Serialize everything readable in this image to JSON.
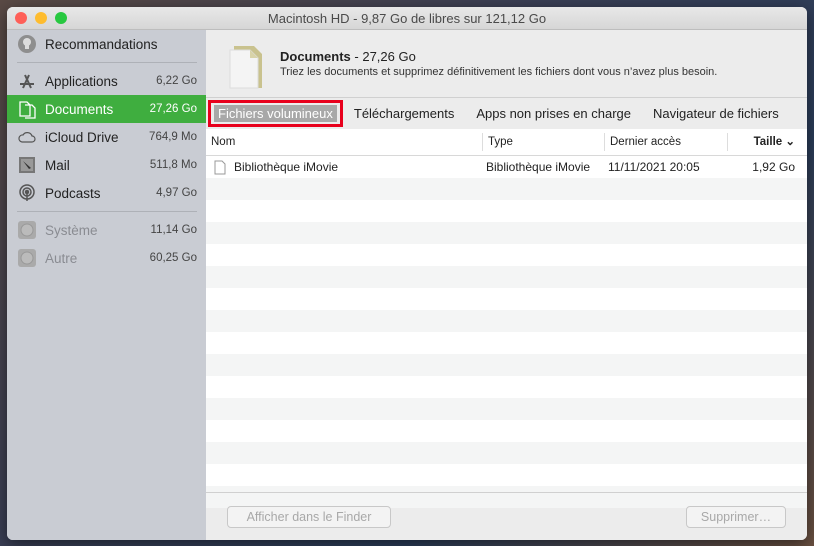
{
  "window": {
    "title": "Macintosh HD - 9,87 Go de libres sur 121,12 Go"
  },
  "sidebar": {
    "items": [
      {
        "label": "Recommandations",
        "size": "",
        "icon": "lightbulb-icon"
      },
      {
        "label": "Applications",
        "size": "6,22 Go",
        "icon": "app-store-icon"
      },
      {
        "label": "Documents",
        "size": "27,26 Go",
        "icon": "documents-icon"
      },
      {
        "label": "iCloud Drive",
        "size": "764,9 Mo",
        "icon": "cloud-icon"
      },
      {
        "label": "Mail",
        "size": "511,8 Mo",
        "icon": "mail-icon"
      },
      {
        "label": "Podcasts",
        "size": "4,97 Go",
        "icon": "podcasts-icon"
      },
      {
        "label": "Système",
        "size": "11,14 Go",
        "icon": "disk-icon"
      },
      {
        "label": "Autre",
        "size": "60,25 Go",
        "icon": "disk-icon"
      }
    ]
  },
  "header": {
    "title": "Documents",
    "size": " - 27,26 Go",
    "description": "Triez les documents et supprimez définitivement les fichiers dont vous n’avez plus besoin."
  },
  "tabs": [
    "Fichiers volumineux",
    "Téléchargements",
    "Apps non prises en charge",
    "Navigateur de fichiers"
  ],
  "table": {
    "columns": [
      "Nom",
      "Type",
      "Dernier accès",
      "Taille ⌄"
    ],
    "rows": [
      {
        "name": "Bibliothèque iMovie",
        "type": "Bibliothèque iMovie",
        "accessed": "11/11/2021 20:05",
        "size": "1,92 Go"
      }
    ]
  },
  "footer": {
    "show_in_finder": "Afficher dans le Finder",
    "delete": "Supprimer…"
  },
  "colors": {
    "accent": "#3fae3f",
    "highlight": "#e8001c"
  }
}
